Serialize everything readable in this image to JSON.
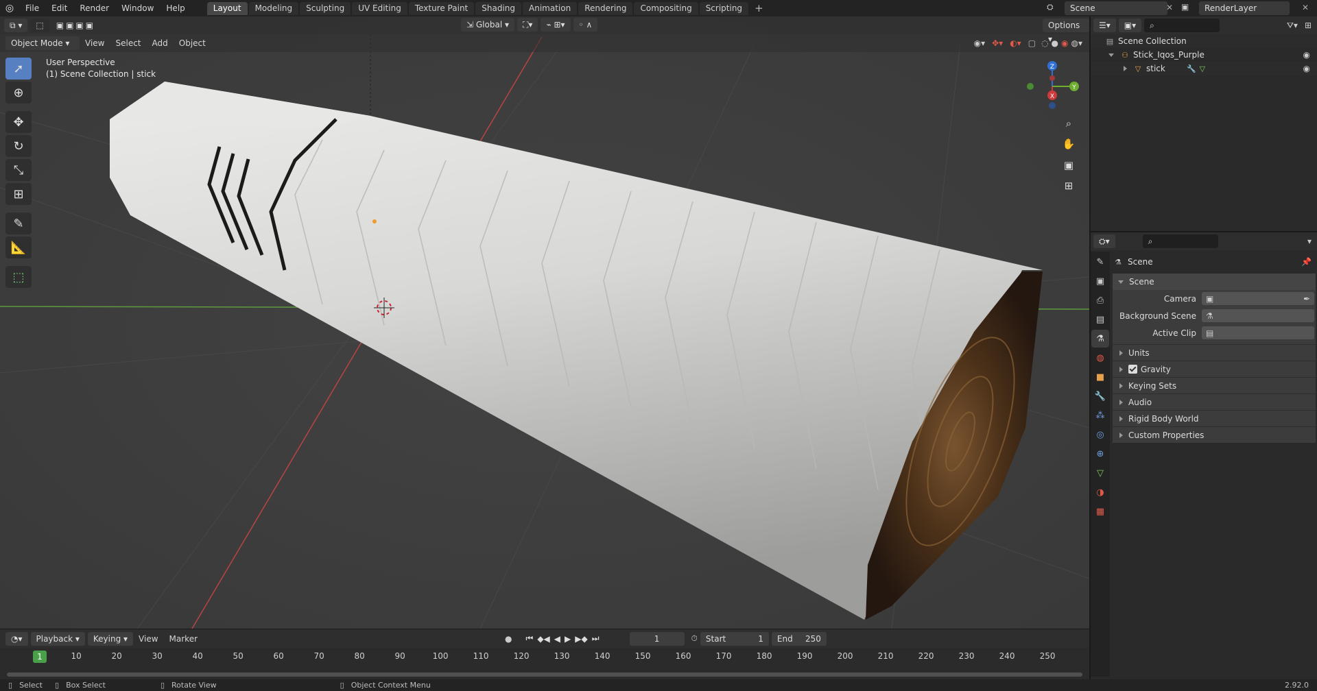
{
  "topbar": {
    "menus": [
      "File",
      "Edit",
      "Render",
      "Window",
      "Help"
    ],
    "workspace_tabs": [
      "Layout",
      "Modeling",
      "Sculpting",
      "UV Editing",
      "Texture Paint",
      "Shading",
      "Animation",
      "Rendering",
      "Compositing",
      "Scripting"
    ],
    "active_tab": "Layout",
    "scene_name": "Scene",
    "view_layer": "RenderLayer"
  },
  "viewport": {
    "mode": "Object Mode",
    "menus": [
      "View",
      "Select",
      "Add",
      "Object"
    ],
    "orientation": "Global",
    "options_label": "Options",
    "perspective_label": "User Perspective",
    "collection_label": "(1) Scene Collection | stick",
    "gizmo_axes": {
      "z": "Z",
      "y": "Y",
      "x": "X"
    },
    "colors": {
      "x_axis": "#cf3a3a",
      "y_axis": "#6fae2e",
      "z_axis": "#2f6fd6",
      "active_tool": "#5680c2",
      "playhead": "#4aa04a"
    }
  },
  "outliner": {
    "root": "Scene Collection",
    "collection": "Stick_Iqos_Purple",
    "object": "stick"
  },
  "properties": {
    "header": "Scene",
    "panel_title": "Scene",
    "fields": [
      {
        "label": "Camera",
        "value": ""
      },
      {
        "label": "Background Scene",
        "value": ""
      },
      {
        "label": "Active Clip",
        "value": ""
      }
    ],
    "subpanels": [
      "Units",
      "Gravity",
      "Keying Sets",
      "Audio",
      "Rigid Body World",
      "Custom Properties"
    ],
    "gravity_checked": true
  },
  "timeline": {
    "menus": [
      "Playback",
      "Keying",
      "View",
      "Marker"
    ],
    "current_frame": "1",
    "start_label": "Start",
    "start": "1",
    "end_label": "End",
    "end": "250",
    "ticks": [
      "1",
      "10",
      "20",
      "30",
      "40",
      "50",
      "60",
      "70",
      "80",
      "90",
      "100",
      "110",
      "120",
      "130",
      "140",
      "150",
      "160",
      "170",
      "180",
      "190",
      "200",
      "210",
      "220",
      "230",
      "240",
      "250"
    ]
  },
  "statusbar": {
    "items": [
      "Select",
      "Box Select",
      "Rotate View",
      "Object Context Menu"
    ],
    "version": "2.92.0"
  }
}
